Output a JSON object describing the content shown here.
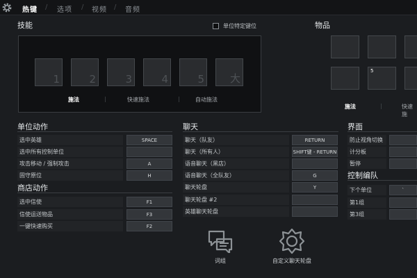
{
  "tabs": [
    "热键",
    "选项",
    "视频",
    "音频"
  ],
  "skills": {
    "title": "技能",
    "checkbox_label": "单位特定键位",
    "slots": [
      "1",
      "2",
      "3",
      "4",
      "5",
      "大"
    ],
    "cast_options": [
      "施法",
      "快速施法",
      "自动施法"
    ]
  },
  "items": {
    "title": "物品",
    "slot_key": "5",
    "cast_options": [
      "施法",
      "快速施"
    ]
  },
  "unit_actions": {
    "title": "单位动作",
    "rows": [
      {
        "label": "选中英雄",
        "key": "SPACE"
      },
      {
        "label": "选中所有控制单位",
        "key": ""
      },
      {
        "label": "攻击移动 / 强制攻击",
        "key": "A"
      },
      {
        "label": "固守原位",
        "key": "H"
      }
    ]
  },
  "shop_actions": {
    "title": "商店动作",
    "rows": [
      {
        "label": "选中信使",
        "key": "F1"
      },
      {
        "label": "信使运送物品",
        "key": "F3"
      },
      {
        "label": "一键快速购买",
        "key": "F2"
      }
    ]
  },
  "chat": {
    "title": "聊天",
    "rows": [
      {
        "label": "聊天（队友）",
        "key": "RETURN"
      },
      {
        "label": "聊天（所有人）",
        "key": "SHIFT键 - RETURN"
      },
      {
        "label": "语音聊天（黑店）",
        "key": ""
      },
      {
        "label": "语音聊天（全队友）",
        "key": "G"
      },
      {
        "label": "聊天轮盘",
        "key": "Y"
      },
      {
        "label": "聊天轮盘 #2",
        "key": ""
      },
      {
        "label": "英雄聊天轮盘",
        "key": ""
      }
    ]
  },
  "interface": {
    "title": "界面",
    "rows": [
      {
        "label": "防止视角切换",
        "key": ""
      },
      {
        "label": "计分板",
        "key": ""
      },
      {
        "label": "暂停",
        "key": ""
      }
    ]
  },
  "control_groups": {
    "title": "控制编队",
    "rows": [
      {
        "label": "下个单位",
        "key": "`"
      },
      {
        "label": "第1组",
        "key": ""
      },
      {
        "label": "第3组",
        "key": ""
      }
    ]
  },
  "bottom": {
    "phrases_label": "词组",
    "custom_wheel_label": "自定义聊天轮盘"
  },
  "icons": {
    "settings": "gear-icon",
    "phrases": "chat-bubbles-icon",
    "custom_wheel": "badge-gear-icon"
  }
}
